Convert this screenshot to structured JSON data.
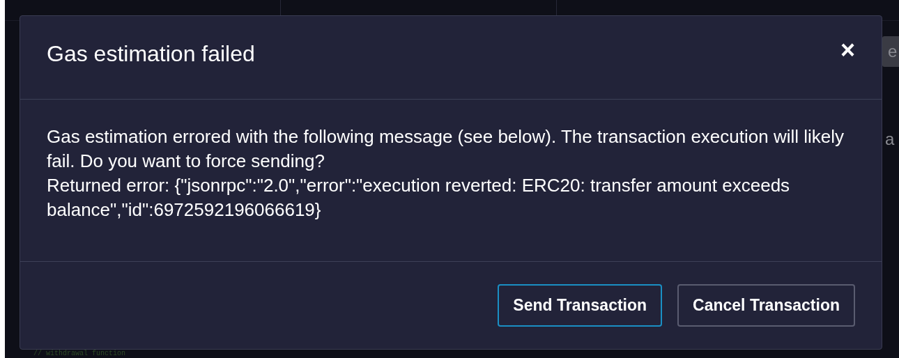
{
  "background": {
    "fragments": [
      {
        "kind": "button",
        "text": "e"
      },
      {
        "kind": "label",
        "text": "a"
      },
      {
        "kind": "code",
        "text": "// withdrawal function"
      }
    ]
  },
  "modal": {
    "title": "Gas estimation failed",
    "close": "×",
    "message": [
      "Gas estimation errored with the following message (see below). The transaction execution will likely fail. Do you want to force sending?",
      "Returned error: {\"jsonrpc\":\"2.0\",\"error\":\"execution reverted: ERC20: transfer amount exceeds balance\",\"id\":6972592196066619}"
    ],
    "buttons": [
      {
        "label": "Send Transaction",
        "selected": true
      },
      {
        "label": "Cancel Transaction",
        "selected": false
      }
    ]
  }
}
